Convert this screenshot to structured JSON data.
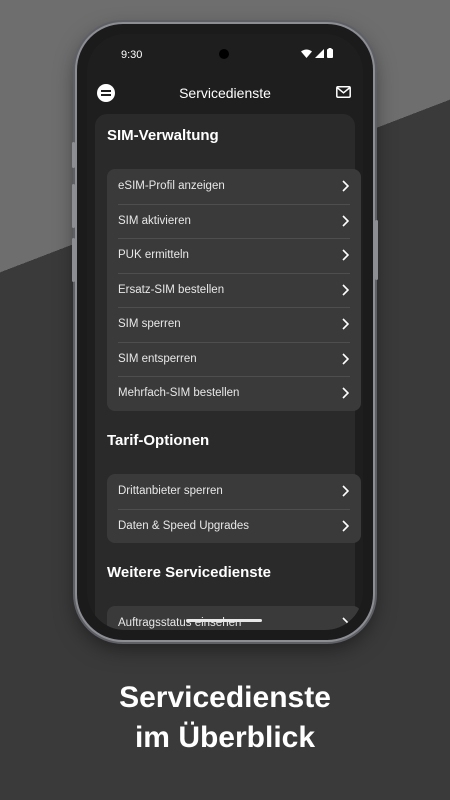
{
  "status_bar": {
    "time": "9:30"
  },
  "header": {
    "title": "Servicedienste"
  },
  "sections": [
    {
      "title": "SIM-Verwaltung",
      "items": [
        "eSIM-Profil anzeigen",
        "SIM aktivieren",
        "PUK ermitteln",
        "Ersatz-SIM bestellen",
        "SIM sperren",
        "SIM entsperren",
        "Mehrfach-SIM bestellen"
      ]
    },
    {
      "title": "Tarif-Optionen",
      "items": [
        "Drittanbieter sperren",
        "Daten & Speed Upgrades"
      ]
    },
    {
      "title": "Weitere Servicedienste",
      "items": [
        "Auftragsstatus einsehen"
      ]
    }
  ],
  "caption": {
    "line1": "Servicedienste",
    "line2": "im Überblick"
  }
}
